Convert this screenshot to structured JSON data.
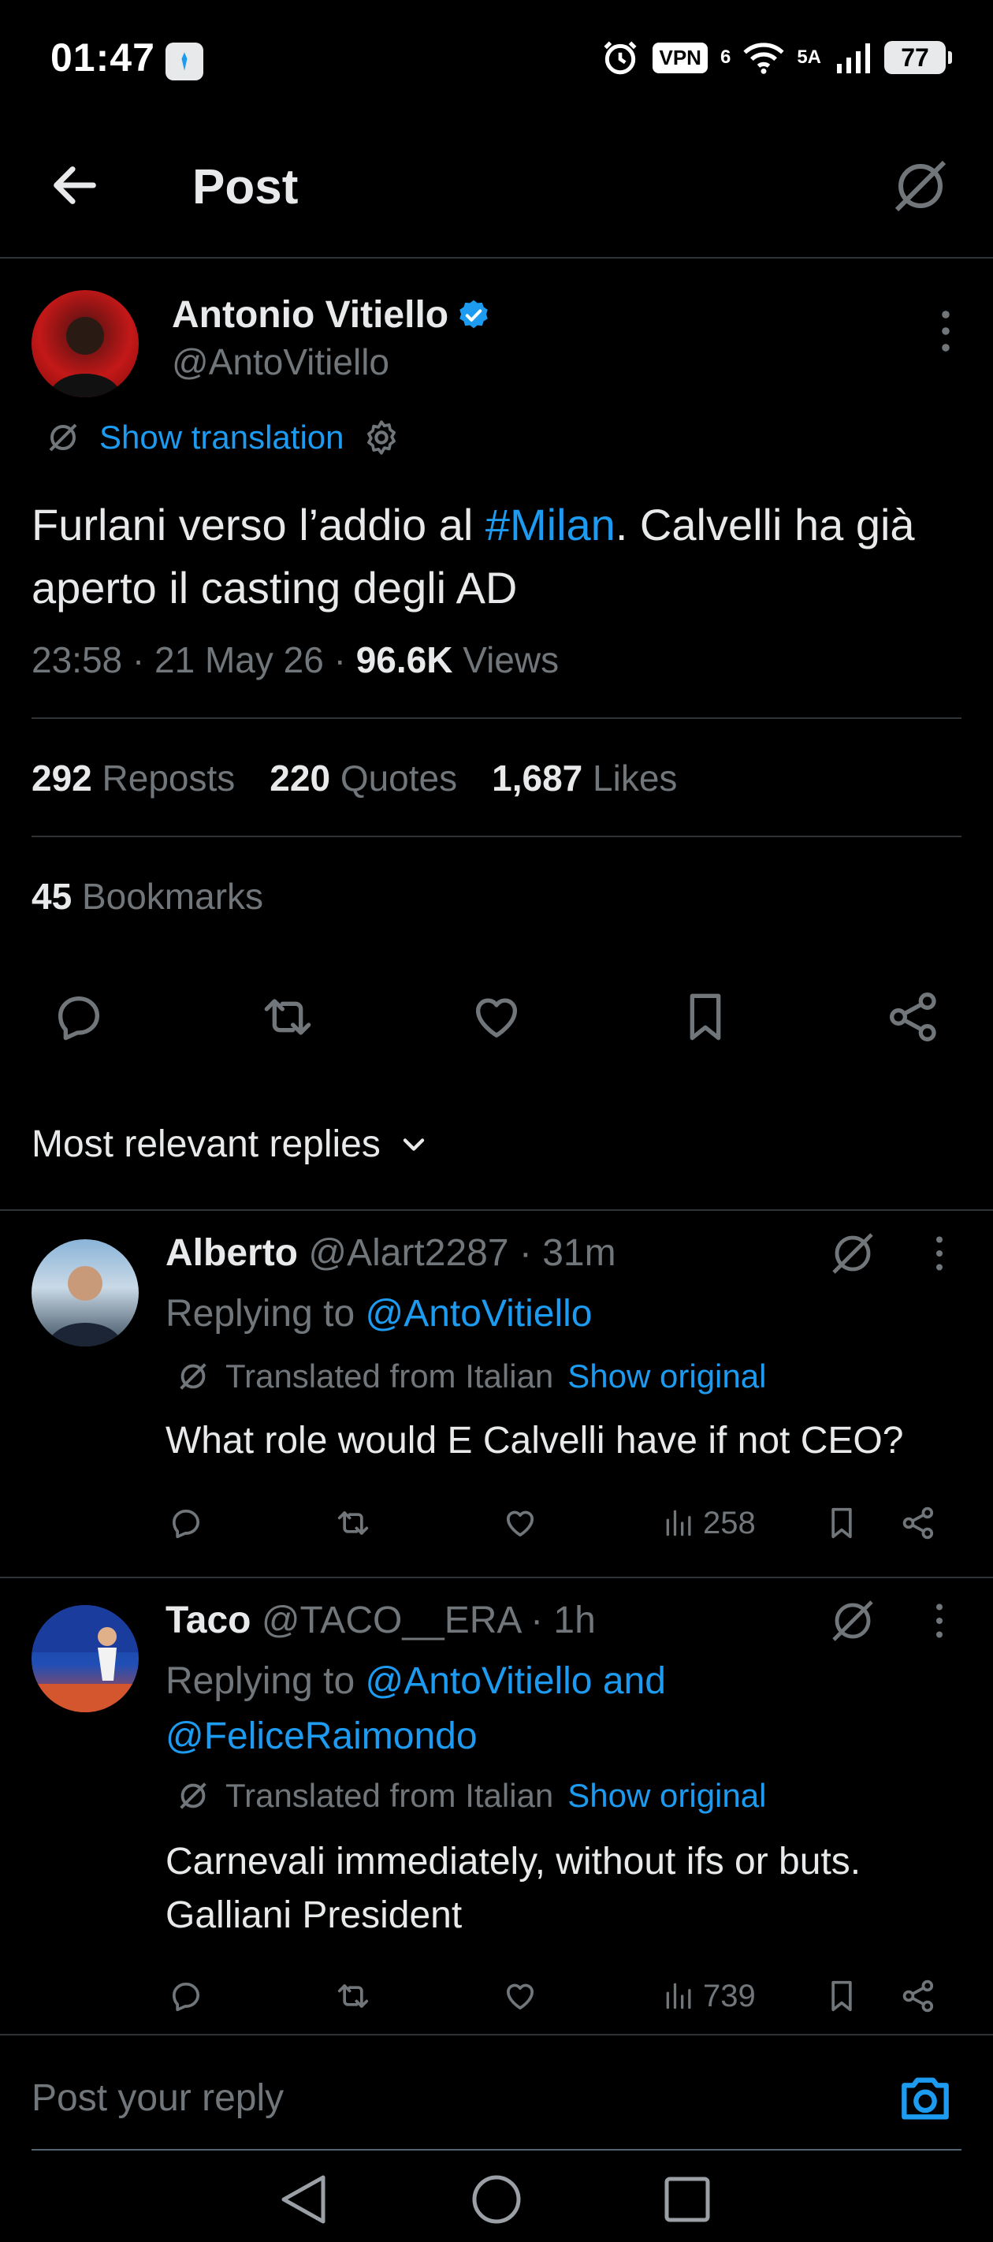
{
  "status_bar": {
    "time": "01:47",
    "vpn_label": "VPN",
    "network_label": "6",
    "signal_label": "5A",
    "battery": "77"
  },
  "header": {
    "title": "Post",
    "back_icon": "arrow-left-icon",
    "grok_icon": "grok-icon"
  },
  "post": {
    "author_name": "Antonio Vitiello",
    "author_handle": "@AntoVitiello",
    "verified": true,
    "show_translation": "Show translation",
    "text_before": "Furlani verso l’addio al ",
    "hashtag": "#Milan",
    "text_after": ". Calvelli ha già aperto il casting degli AD",
    "time": "23:58",
    "date": "21 May 26",
    "views_count": "96.6K",
    "views_label": "Views",
    "reposts_count": "292",
    "reposts_label": "Reposts",
    "quotes_count": "220",
    "quotes_label": "Quotes",
    "likes_count": "1,687",
    "likes_label": "Likes",
    "bookmarks_count": "45",
    "bookmarks_label": "Bookmarks"
  },
  "sort": {
    "label": "Most relevant replies"
  },
  "replies": [
    {
      "name": "Alberto",
      "handle": "@Alart2287",
      "time": "· 31m",
      "replying_prefix": "Replying to ",
      "replying_to": "@AntoVitiello",
      "translated_label": "Translated from Italian",
      "show_original": "Show original",
      "text": "What role would E Calvelli have if not CEO?",
      "views": "258"
    },
    {
      "name": "Taco",
      "handle": "@TACO__ERA",
      "time": "· 1h",
      "replying_prefix": "Replying to ",
      "replying_to": "@AntoVitiello and",
      "replying_to_2": "@FeliceRaimondo",
      "translated_label": "Translated from Italian",
      "show_original": "Show original",
      "text": "Carnevali immediately, without ifs or buts. Galliani President",
      "views": "739"
    }
  ],
  "composer": {
    "placeholder": "Post your reply"
  },
  "colors": {
    "background": "#000000",
    "text": "#e7e9ea",
    "muted": "#71767b",
    "accent": "#1d9bf0",
    "divider": "#2f3336"
  }
}
